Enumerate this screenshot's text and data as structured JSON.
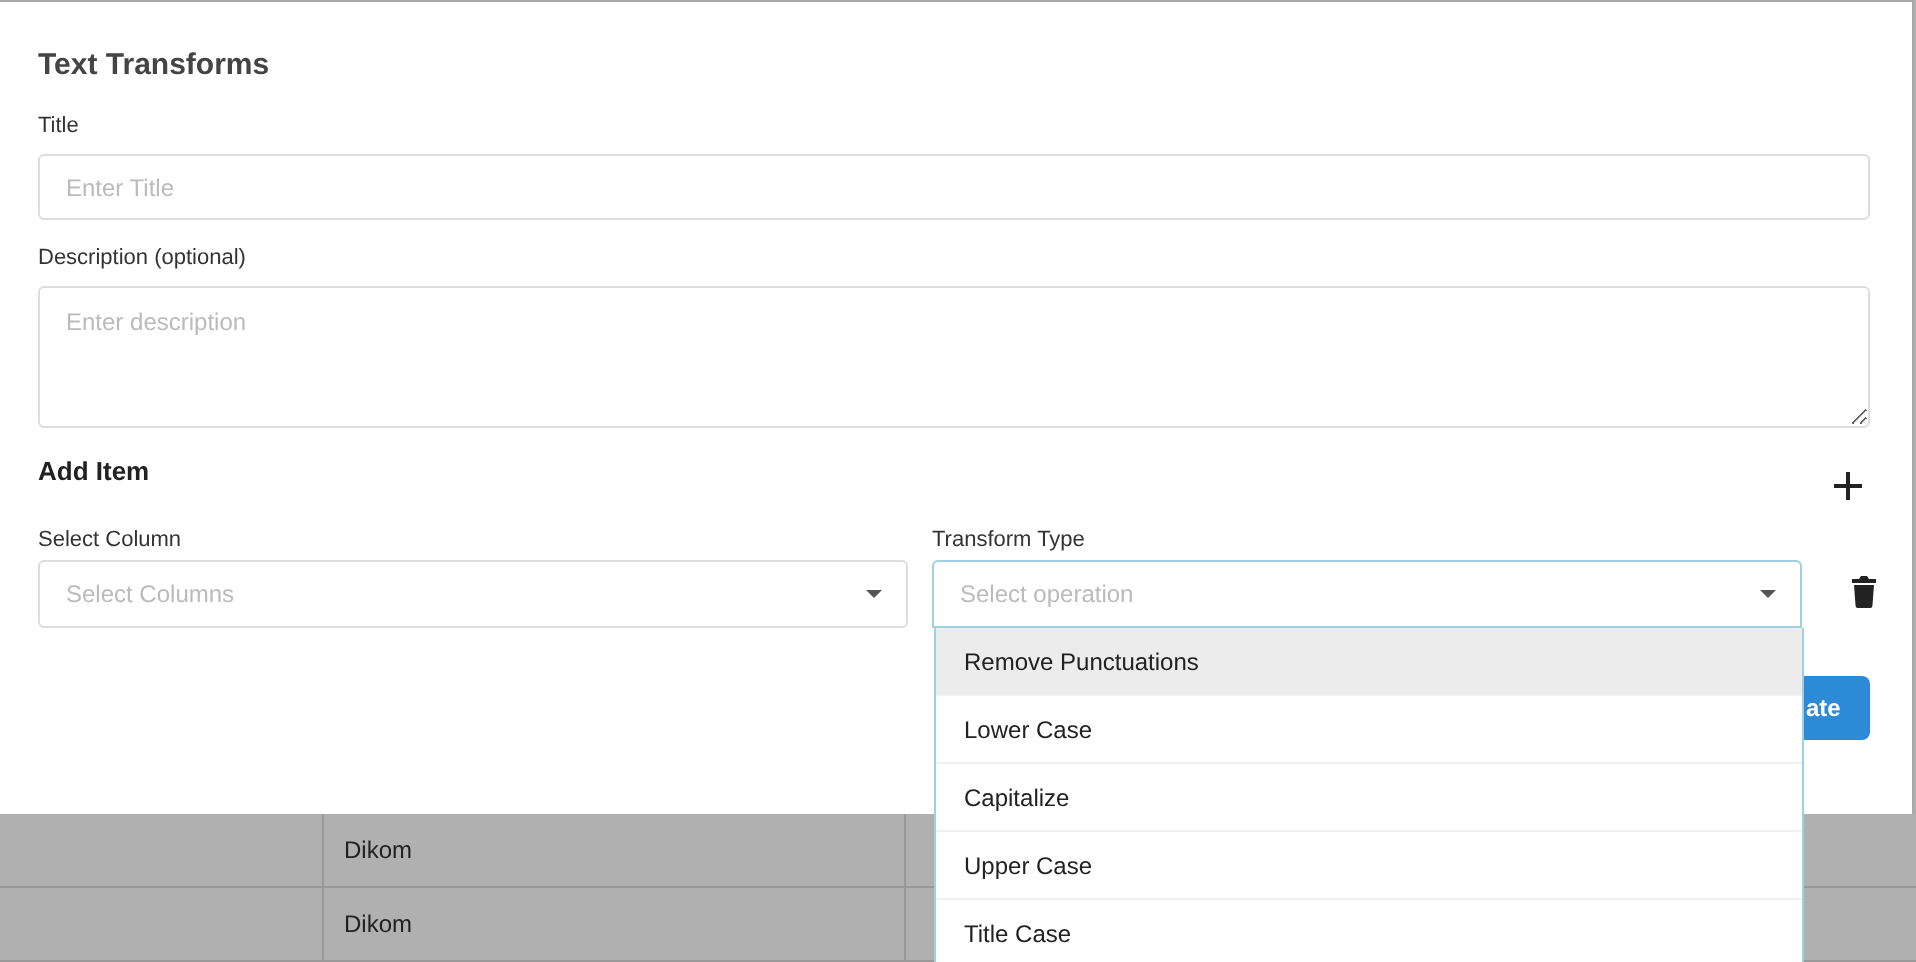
{
  "dialog": {
    "title": "Text Transforms",
    "title_field": {
      "label": "Title",
      "placeholder": "Enter Title"
    },
    "description_field": {
      "label": "Description (optional)",
      "placeholder": "Enter description"
    },
    "add_item": {
      "heading": "Add Item"
    },
    "column_select": {
      "label": "Select Column",
      "placeholder": "Select Columns"
    },
    "transform_select": {
      "label": "Transform Type",
      "placeholder": "Select operation",
      "expanded": true,
      "options": [
        {
          "label": "Remove Punctuations",
          "highlighted": true
        },
        {
          "label": "Lower Case",
          "highlighted": false
        },
        {
          "label": "Capitalize",
          "highlighted": false
        },
        {
          "label": "Upper Case",
          "highlighted": false
        },
        {
          "label": "Title Case",
          "highlighted": false
        }
      ]
    },
    "submit_button": "ate"
  },
  "background_table": {
    "rows": [
      {
        "cells": [
          "",
          "Dikom",
          ""
        ]
      },
      {
        "cells": [
          "",
          "Dikom",
          ""
        ]
      }
    ]
  }
}
